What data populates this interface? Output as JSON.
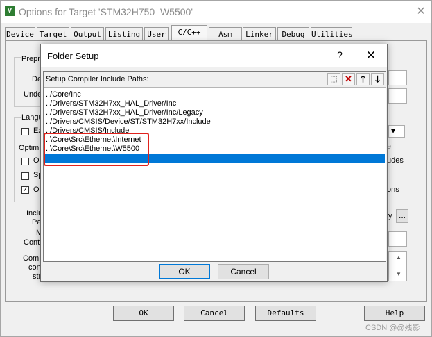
{
  "window": {
    "title": "Options for Target 'STM32H750_W5500'",
    "icon_glyph": "V",
    "close_glyph": "✕"
  },
  "tabs": [
    "Device",
    "Target",
    "Output",
    "Listing",
    "User",
    "C/C++",
    "Asm",
    "Linker",
    "Debug",
    "Utilities"
  ],
  "active_tab": "C/C++",
  "background_fragments": {
    "preprocessor_group": "Prepro",
    "define": "De",
    "undefine": "Unde",
    "language_group": "Langu",
    "execute_only": "Ex",
    "optimization": "Optimiz",
    "opt_checkbox_1": "Op",
    "split_checkbox": "Sp",
    "one_elf_checkbox": "On",
    "include_label": "Inclu",
    "paths_label": "Pat",
    "misc_label": "M",
    "controls_label": "Contr",
    "compiler_label": "Comp",
    "control_label": "con",
    "string_label": "str",
    "right_e": "e",
    "right_udes": "udes",
    "right_ons": "ons",
    "right_y": "y",
    "ellipsis_button": "...",
    "dropdown_arrow": "▾",
    "scroll_up": "▲",
    "scroll_down": "▼"
  },
  "bottom_buttons": {
    "ok": "OK",
    "cancel": "Cancel",
    "defaults": "Defaults",
    "help": "Help"
  },
  "watermark": "CSDN @@残影",
  "folder_setup": {
    "title": "Folder Setup",
    "help_glyph": "?",
    "close_glyph": "✕",
    "header_label": "Setup Compiler Include Paths:",
    "toolbar": {
      "new_glyph": "⬚",
      "delete_glyph": "✕",
      "move_up_glyph": "🡑",
      "move_down_glyph": "🡓"
    },
    "paths": [
      "../Core/Inc",
      "../Drivers/STM32H7xx_HAL_Driver/Inc",
      "../Drivers/STM32H7xx_HAL_Driver/Inc/Legacy",
      "../Drivers/CMSIS/Device/ST/STM32H7xx/Include",
      "../Drivers/CMSIS/Include",
      "..\\Core\\Src\\Ethernet\\Internet",
      "..\\Core\\Src\\Ethernet\\W5500",
      ""
    ],
    "selected_index": 7,
    "ok_label": "OK",
    "cancel_label": "Cancel",
    "colors": {
      "selection": "#0078d7",
      "highlight_box": "#e0221c"
    }
  }
}
